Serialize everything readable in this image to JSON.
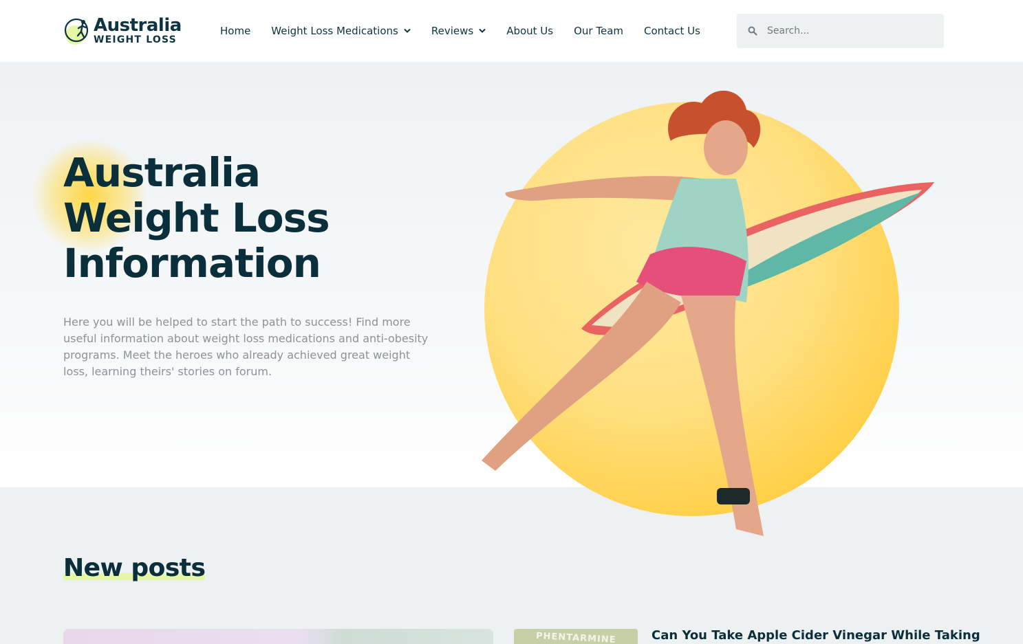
{
  "brand": {
    "name_line1": "Australia",
    "name_line2": "WEIGHT LOSS",
    "icon": "runner-logo-icon"
  },
  "nav": {
    "items": [
      {
        "label": "Home",
        "has_dropdown": false
      },
      {
        "label": "Weight Loss Medications",
        "has_dropdown": true
      },
      {
        "label": "Reviews",
        "has_dropdown": true
      },
      {
        "label": "About Us",
        "has_dropdown": false
      },
      {
        "label": "Our Team",
        "has_dropdown": false
      },
      {
        "label": "Contact Us",
        "has_dropdown": false
      }
    ]
  },
  "search": {
    "placeholder": "Search...",
    "icon": "search-icon"
  },
  "hero": {
    "title_line1": "Australia",
    "title_line2": "Weight Loss",
    "title_line3": "Information",
    "description": "Here you will be helped to start the path to success! Find more useful information about weight loss medications and anti-obesity programs. Meet the heroes who already achieved great weight loss, learning theirs' stories on forum.",
    "image": "woman-with-surfboard-jumping"
  },
  "posts": {
    "heading": "New posts",
    "items": [
      {
        "thumbnail_text": "PHENTARMINE",
        "title": "Can You Take Apple Cider Vinegar While Taking"
      }
    ]
  },
  "colors": {
    "primary_text": "#0a2f3b",
    "accent_yellow": "#ffd04a",
    "highlight_green": "#e6f7a8",
    "muted_text": "#8a9498",
    "search_bg": "#eef1f2"
  }
}
